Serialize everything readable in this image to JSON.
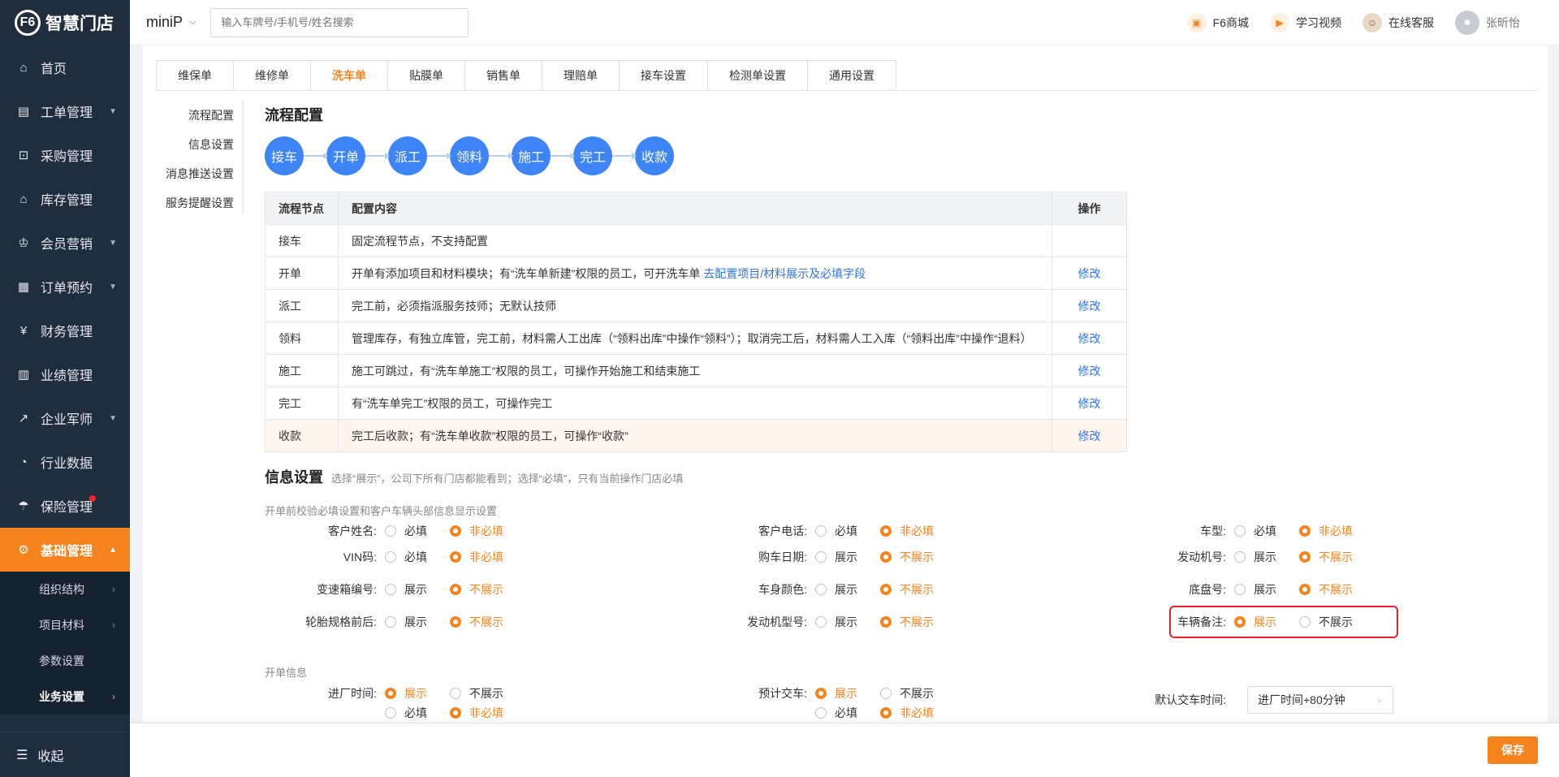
{
  "brand": {
    "name": "智慧门店",
    "logo_mark": "F6"
  },
  "sidebar": {
    "items": [
      {
        "label": "首页",
        "icon": "home-icon",
        "glyph": "⌂"
      },
      {
        "label": "工单管理",
        "icon": "workorder-icon",
        "glyph": "▤"
      },
      {
        "label": "采购管理",
        "icon": "cart-icon",
        "glyph": "⊡"
      },
      {
        "label": "库存管理",
        "icon": "warehouse-icon",
        "glyph": "⌂"
      },
      {
        "label": "会员营销",
        "icon": "crown-icon",
        "glyph": "♔"
      },
      {
        "label": "订单预约",
        "icon": "calendar-icon",
        "glyph": "▦"
      },
      {
        "label": "财务管理",
        "icon": "yen-icon",
        "glyph": "¥"
      },
      {
        "label": "业绩管理",
        "icon": "bar-chart-icon",
        "glyph": "▥"
      },
      {
        "label": "企业军师",
        "icon": "trend-icon",
        "glyph": "↗"
      },
      {
        "label": "行业数据",
        "icon": "gauge-icon",
        "glyph": "◔"
      },
      {
        "label": "保险管理",
        "icon": "umbrella-icon",
        "glyph": "☂"
      },
      {
        "label": "基础管理",
        "icon": "settings-icon",
        "glyph": "⚙"
      }
    ],
    "sub_items": [
      {
        "label": "组织结构"
      },
      {
        "label": "项目材料"
      },
      {
        "label": "参数设置"
      },
      {
        "label": "业务设置"
      }
    ],
    "collapse_label": "收起"
  },
  "topbar": {
    "store": "miniP",
    "search_placeholder": "输入车牌号/手机号/姓名搜索",
    "mall": "F6商城",
    "video": "学习视频",
    "service": "在线客服",
    "user": "张昕怡"
  },
  "tabs": [
    "维保单",
    "维修单",
    "洗车单",
    "贴膜单",
    "销售单",
    "理赔单",
    "接车设置",
    "检测单设置",
    "通用设置"
  ],
  "subnav": [
    "流程配置",
    "信息设置",
    "消息推送设置",
    "服务提醒设置"
  ],
  "flow": {
    "title": "流程配置",
    "nodes": [
      "接车",
      "开单",
      "派工",
      "领料",
      "施工",
      "完工",
      "收款"
    ]
  },
  "table": {
    "headers": [
      "流程节点",
      "配置内容",
      "操作"
    ],
    "rows": [
      {
        "node": "接车",
        "content": "固定流程节点，不支持配置",
        "link": "",
        "op": ""
      },
      {
        "node": "开单",
        "content": "开单有添加项目和材料模块；有“洗车单新建”权限的员工，可开洗车单",
        "link": "去配置项目/材料展示及必填字段",
        "op": "修改"
      },
      {
        "node": "派工",
        "content": "完工前，必须指派服务技师；无默认技师",
        "link": "",
        "op": "修改"
      },
      {
        "node": "领料",
        "content": "管理库存，有独立库管，完工前，材料需人工出库（“领料出库”中操作“领料”）；取消完工后，材料需人工入库（“领料出库”中操作“退料）",
        "link": "",
        "op": "修改"
      },
      {
        "node": "施工",
        "content": "施工可跳过，有“洗车单施工”权限的员工，可操作开始施工和结束施工",
        "link": "",
        "op": "修改"
      },
      {
        "node": "完工",
        "content": "有“洗车单完工”权限的员工，可操作完工",
        "link": "",
        "op": "修改"
      },
      {
        "node": "收款",
        "content": "完工后收款；有“洗车单收款”权限的员工，可操作“收款”",
        "link": "",
        "op": "修改"
      }
    ]
  },
  "info": {
    "title": "信息设置",
    "note": "选择“展示”，公司下所有门店都能看到；选择“必填”，只有当前操作门店必填",
    "group1": "开单前校验必填设置和客户车辆头部信息显示设置",
    "group2": "开单信息",
    "fields": {
      "customer_name": {
        "label": "客户姓名:",
        "opt1": "必填",
        "opt2": "非必填"
      },
      "customer_phone": {
        "label": "客户电话:",
        "opt1": "必填",
        "opt2": "非必填"
      },
      "car_model": {
        "label": "车型:",
        "opt1": "必填",
        "opt2": "非必填"
      },
      "vin": {
        "label": "VIN码:",
        "opt1": "必填",
        "opt2": "非必填"
      },
      "purchase_date": {
        "label": "购车日期:",
        "opt1": "展示",
        "opt2": "不展示"
      },
      "engine_no": {
        "label": "发动机号:",
        "opt1": "展示",
        "opt2": "不展示"
      },
      "gearbox_no": {
        "label": "变速箱编号:",
        "opt1": "展示",
        "opt2": "不展示"
      },
      "body_color": {
        "label": "车身颜色:",
        "opt1": "展示",
        "opt2": "不展示"
      },
      "chassis_no": {
        "label": "底盘号:",
        "opt1": "展示",
        "opt2": "不展示"
      },
      "tire_spec": {
        "label": "轮胎规格前后:",
        "opt1": "展示",
        "opt2": "不展示"
      },
      "engine_model": {
        "label": "发动机型号:",
        "opt1": "展示",
        "opt2": "不展示"
      },
      "vehicle_remark": {
        "label": "车辆备注:",
        "opt1": "展示",
        "opt2": "不展示"
      },
      "enter_time": {
        "label": "进厂时间:",
        "opt1": "展示",
        "opt2": "不展示",
        "opt3": "必填",
        "opt4": "非必填"
      },
      "delivery_time": {
        "label": "预计交车:",
        "opt1": "展示",
        "opt2": "不展示",
        "opt3": "必填",
        "opt4": "非必填"
      }
    },
    "default_delivery": {
      "label": "默认交车时间:",
      "value": "进厂时间+80分钟"
    }
  },
  "footer": {
    "save": "保存"
  },
  "colors": {
    "accent": "#f5841f",
    "sidebar": "#1f2d3d",
    "flow_node": "#3d84f7",
    "highlight_border": "#e6202b"
  }
}
